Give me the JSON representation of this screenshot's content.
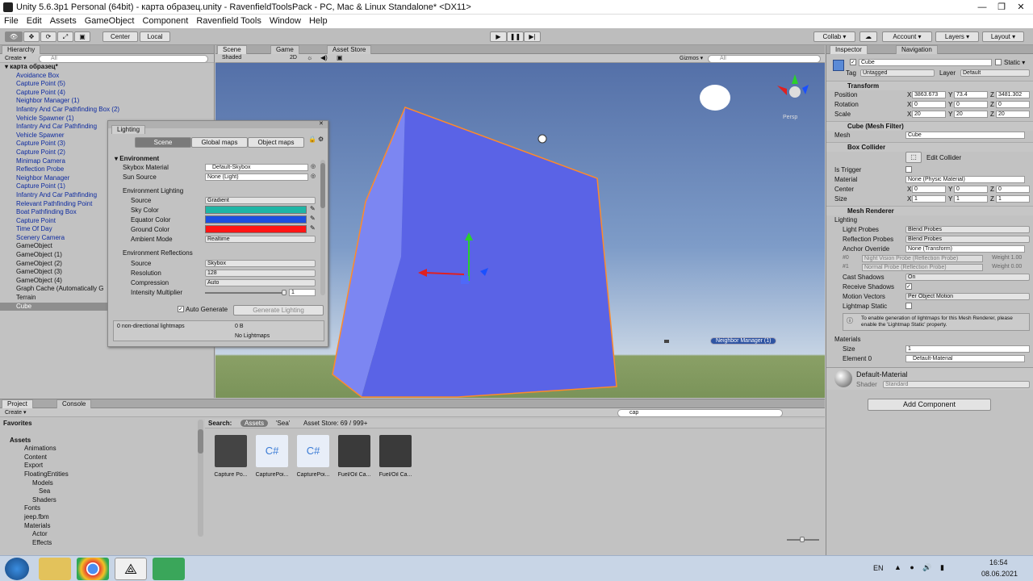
{
  "window": {
    "title": "Unity 5.6.3p1 Personal (64bit) - карта образец.unity - RavenfieldToolsPack - PC, Mac & Linux Standalone* <DX11>"
  },
  "menu": [
    "File",
    "Edit",
    "Assets",
    "GameObject",
    "Component",
    "Ravenfield Tools",
    "Window",
    "Help"
  ],
  "toolbar": {
    "center": "Center",
    "local": "Local",
    "collab": "Collab ▾",
    "account": "Account ▾",
    "layers": "Layers ▾",
    "layout": "Layout ▾"
  },
  "hierarchy": {
    "tab": "Hierarchy",
    "create": "Create ▾",
    "search": "All",
    "scene": "карта образец*",
    "items": [
      "Avoidance Box",
      "Capture Point (5)",
      "Capture Point (4)",
      "Neighbor Manager (1)",
      "Infantry And Car Pathfinding Box (2)",
      "Vehicle Spawner (1)",
      "Infantry And Car Pathfinding",
      "Vehicle Spawner",
      "Capture Point (3)",
      "Capture Point (2)",
      "Minimap Camera",
      "Reflection Probe",
      "Neighbor Manager",
      "Capture Point (1)",
      "Infantry And Car Pathfinding",
      "Relevant Pathfinding Point",
      "Boat Pathfinding Box",
      "Capture Point",
      "Time Of Day",
      "Scenery Camera",
      "GameObject",
      "GameObject (1)",
      "GameObject (2)",
      "GameObject (3)",
      "GameObject (4)",
      "Graph Cache (Automatically G",
      "Terrain",
      "Cube"
    ]
  },
  "scene": {
    "tabs": [
      "Scene",
      "Game",
      "Asset Store"
    ],
    "shaded": "Shaded",
    "mode2d": "2D",
    "gizmos": "Gizmos ▾",
    "search": "All",
    "persp": "Persp",
    "label": "Neighbor Manager (1)"
  },
  "lighting": {
    "title": "Lighting",
    "tabs": [
      "Scene",
      "Global maps",
      "Object maps"
    ],
    "environment": "Environment",
    "skybox_label": "Skybox Material",
    "skybox_value": "Default-Skybox",
    "sun_label": "Sun Source",
    "sun_value": "None (Light)",
    "env_lighting": "Environment Lighting",
    "source_label": "Source",
    "source_value": "Gradient",
    "sky_label": "Sky Color",
    "equator_label": "Equator Color",
    "ground_label": "Ground Color",
    "ambient_label": "Ambient Mode",
    "ambient_value": "Realtime",
    "env_reflections": "Environment Reflections",
    "rsource_label": "Source",
    "rsource_value": "Skybox",
    "resolution_label": "Resolution",
    "resolution_value": "128",
    "compression_label": "Compression",
    "compression_value": "Auto",
    "intensity_label": "Intensity Multiplier",
    "intensity_value": "1",
    "auto_generate": "Auto Generate",
    "generate": "Generate Lighting",
    "lightmaps": "0 non-directional lightmaps",
    "size": "0 B",
    "nolightmaps": "No Lightmaps",
    "colors": {
      "sky": "#1fb5a5",
      "equator": "#1b4fe0",
      "ground": "#ff1515"
    }
  },
  "inspector": {
    "tabs": [
      "Inspector",
      "Navigation"
    ],
    "name": "Cube",
    "static": "Static ▾",
    "tag_label": "Tag",
    "tag_value": "Untagged",
    "layer_label": "Layer",
    "layer_value": "Default",
    "transform": {
      "title": "Transform",
      "position": "Position",
      "rotation": "Rotation",
      "scale": "Scale",
      "px": "3863.673",
      "py": "73.4",
      "pz": "3481.302",
      "rx": "0",
      "ry": "0",
      "rz": "0",
      "sx": "20",
      "sy": "20",
      "sz": "20"
    },
    "meshfilter": {
      "title": "Cube (Mesh Filter)",
      "mesh_label": "Mesh",
      "mesh_value": "Cube"
    },
    "boxcollider": {
      "title": "Box Collider",
      "edit": "Edit Collider",
      "trigger": "Is Trigger",
      "material_label": "Material",
      "material_value": "None (Physic Material)",
      "center": "Center",
      "size": "Size",
      "cx": "0",
      "cy": "0",
      "cz": "0",
      "sx": "1",
      "sy": "1",
      "sz": "1"
    },
    "meshrenderer": {
      "title": "Mesh Renderer",
      "lighting": "Lighting",
      "lightprobes": "Light Probes",
      "lightprobes_v": "Blend Probes",
      "reflprobes": "Reflection Probes",
      "reflprobes_v": "Blend Probes",
      "anchor": "Anchor Override",
      "anchor_v": "None (Transform)",
      "p0": "#0",
      "p0v": "Night Vision Probe (Reflection Probe)",
      "p0w": "Weight 1.00",
      "p1": "#1",
      "p1v": "Normal Probe (Reflection Probe)",
      "p1w": "Weight 0.00",
      "cast": "Cast Shadows",
      "cast_v": "On",
      "receive": "Receive Shadows",
      "motion": "Motion Vectors",
      "motion_v": "Per Object Motion",
      "lmstatic": "Lightmap Static",
      "info": "To enable generation of lightmaps for this Mesh Renderer, please enable the 'Lightmap Static' property.",
      "materials": "Materials",
      "msize": "Size",
      "msize_v": "1",
      "elem": "Element 0",
      "elem_v": "Default-Material"
    },
    "material": {
      "name": "Default-Material",
      "shader_label": "Shader",
      "shader_value": "Standard"
    },
    "add_component": "Add Component"
  },
  "project": {
    "tabs": [
      "Project",
      "Console"
    ],
    "create": "Create ▾",
    "favorites": "Favorites",
    "tree": [
      "Assets",
      "Animations",
      "Content",
      "Export",
      "FloatingEntities",
      "Models",
      "Sea",
      "Shaders",
      "Fonts",
      "jeep.fbm",
      "Materials",
      "Actor",
      "Effects"
    ],
    "search_label": "Search:",
    "filter_assets": "Assets",
    "filter_sea": "'Sea'",
    "asset_store": "Asset Store: 69 / 999+",
    "search_value": "cap",
    "assets": [
      "Capture Po...",
      "CapturePoi...",
      "CapturePoi...",
      "Fuel/Oil Ca...",
      "Fuel/Oil Ca..."
    ]
  },
  "taskbar": {
    "lang": "EN",
    "time": "16:54",
    "date": "08.06.2021"
  }
}
